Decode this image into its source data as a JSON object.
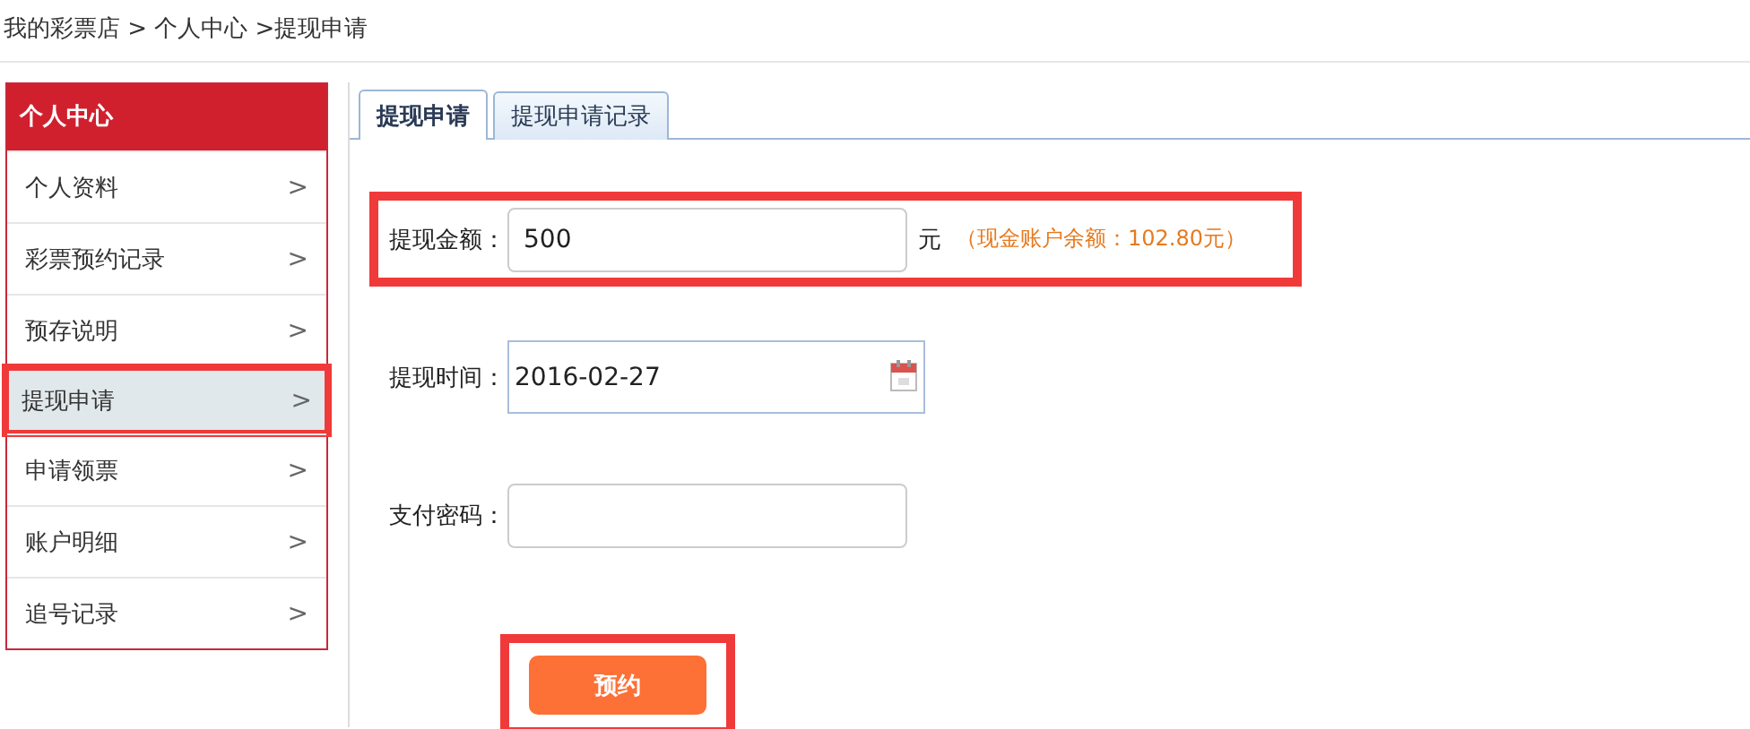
{
  "breadcrumb": {
    "text": "我的彩票店 > 个人中心 >提现申请"
  },
  "sidebar": {
    "title": "个人中心",
    "items": [
      {
        "label": "个人资料",
        "selected": false,
        "highlighted": false
      },
      {
        "label": "彩票预约记录",
        "selected": false,
        "highlighted": false
      },
      {
        "label": "预存说明",
        "selected": false,
        "highlighted": false
      },
      {
        "label": "提现申请",
        "selected": true,
        "highlighted": true
      },
      {
        "label": "申请领票",
        "selected": false,
        "highlighted": false
      },
      {
        "label": "账户明细",
        "selected": false,
        "highlighted": false
      },
      {
        "label": "追号记录",
        "selected": false,
        "highlighted": false
      }
    ]
  },
  "chevron": ">",
  "tabs": [
    {
      "label": "提现申请",
      "selected": true
    },
    {
      "label": "提现申请记录",
      "selected": false
    }
  ],
  "form": {
    "fields": [
      {
        "kind": "amount",
        "label": "提现金额：",
        "value": "500",
        "unit": "元",
        "note": "（现金账户余额：102.80元）",
        "highlighted": true
      },
      {
        "kind": "date",
        "label": "提现时间：",
        "value": "2016-02-27",
        "highlighted": false
      },
      {
        "kind": "password",
        "label": "支付密码：",
        "highlighted": false
      }
    ]
  },
  "submit": {
    "label": "预约",
    "highlighted": true
  }
}
